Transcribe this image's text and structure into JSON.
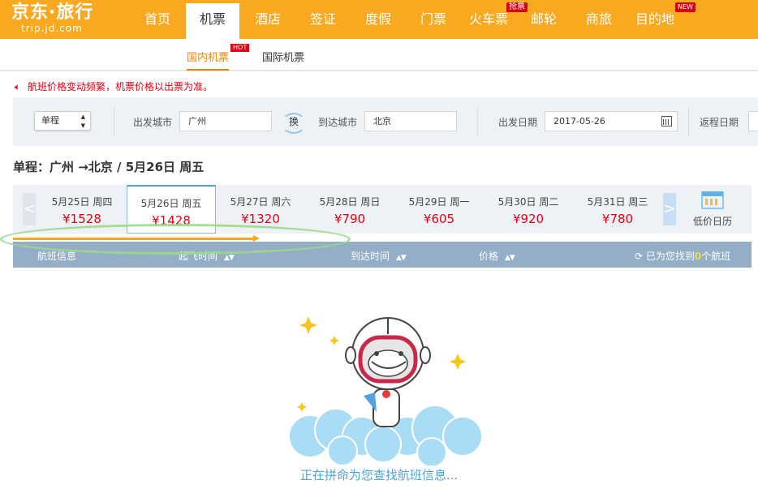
{
  "logo": {
    "cn": "京东·旅行",
    "en": "trip.jd.com"
  },
  "nav": {
    "items": [
      {
        "label": "首页"
      },
      {
        "label": "机票"
      },
      {
        "label": "酒店"
      },
      {
        "label": "签证"
      },
      {
        "label": "度假"
      },
      {
        "label": "门票"
      },
      {
        "label": "火车票",
        "badge": "抢票"
      },
      {
        "label": "邮轮"
      },
      {
        "label": "商旅"
      },
      {
        "label": "目的地",
        "badge": "NEW"
      }
    ]
  },
  "subnav": {
    "domestic": "国内机票",
    "domestic_badge": "HOT",
    "international": "国际机票"
  },
  "notice": "航班价格变动频繁，机票价格以出票为准。",
  "search": {
    "trip_type": "单程",
    "from_label": "出发城市",
    "from_value": "广州",
    "swap_label": "换",
    "to_label": "到达城市",
    "to_value": "北京",
    "depart_label": "出发日期",
    "depart_value": "2017-05-26",
    "return_label": "返程日期"
  },
  "route_title": "单程：广州 →北京  /  5月26日 周五",
  "dates": [
    {
      "date": "5月25日 周四",
      "price": "¥1528"
    },
    {
      "date": "5月26日 周五",
      "price": "¥1428"
    },
    {
      "date": "5月27日 周六",
      "price": "¥1320"
    },
    {
      "date": "5月28日 周日",
      "price": "¥790"
    },
    {
      "date": "5月29日 周一",
      "price": "¥605"
    },
    {
      "date": "5月30日 周二",
      "price": "¥920"
    },
    {
      "date": "5月31日 周三",
      "price": "¥780"
    }
  ],
  "low_price_calendar": "低价日历",
  "table_header": {
    "flight_info": "航班信息",
    "depart_time": "起飞时间",
    "arrive_time": "到达时间",
    "price": "价格",
    "found_prefix": "已为您找到",
    "found_count": "0",
    "found_suffix": "个航班"
  },
  "loading_text": "正在拼命为您查找航班信息..."
}
